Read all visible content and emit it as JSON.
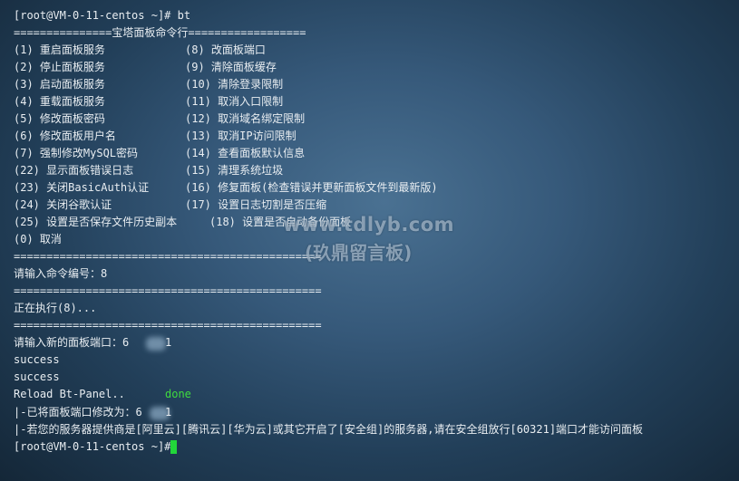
{
  "terminal": {
    "prompt_cmd": "[root@VM-0-11-centos ~]# bt",
    "menu_header": "===============宝塔面板命令行==================",
    "menu": [
      {
        "left": "(1) 重启面板服务",
        "right": "(8) 改面板端口"
      },
      {
        "left": "(2) 停止面板服务",
        "right": "(9) 清除面板缓存"
      },
      {
        "left": "(3) 启动面板服务",
        "right": "(10) 清除登录限制"
      },
      {
        "left": "(4) 重载面板服务",
        "right": "(11) 取消入口限制"
      },
      {
        "left": "(5) 修改面板密码",
        "right": "(12) 取消域名绑定限制"
      },
      {
        "left": "(6) 修改面板用户名",
        "right": "(13) 取消IP访问限制"
      },
      {
        "left": "(7) 强制修改MySQL密码",
        "right": "(14) 查看面板默认信息"
      },
      {
        "left": "(22) 显示面板错误日志",
        "right": "(15) 清理系统垃圾"
      },
      {
        "left": "(23) 关闭BasicAuth认证",
        "right": "(16) 修复面板(检查错误并更新面板文件到最新版)"
      },
      {
        "left": "(24) 关闭谷歌认证",
        "right": "(17) 设置日志切割是否压缩"
      },
      {
        "left": "(25) 设置是否保存文件历史副本",
        "right": "(18) 设置是否自动备份面板"
      }
    ],
    "menu_cancel": "(0) 取消",
    "separator": "===============================================",
    "input_cmd": "请输入命令编号：8",
    "executing": "正在执行(8)...",
    "new_port_prefix": "请输入新的面板端口：6",
    "port_suffix": "1",
    "success1": "success",
    "success2": "success",
    "reload": "Reload Bt-Panel..",
    "done": "done",
    "port_changed_prefix": "|-已将面板端口修改为：6",
    "security_notice": "|-若您的服务器提供商是[阿里云][腾讯云][华为云]或其它开启了[安全组]的服务器,请在安全组放行[60321]端口才能访问面板",
    "final_prompt": "[root@VM-0-11-centos ~]#"
  },
  "watermark": {
    "site": "www.tdlyb.com",
    "name": "(玖鼎留言板)"
  },
  "colors": {
    "text": "#e8edf1",
    "done": "#3fdc3f",
    "cursor": "#22d63a"
  }
}
